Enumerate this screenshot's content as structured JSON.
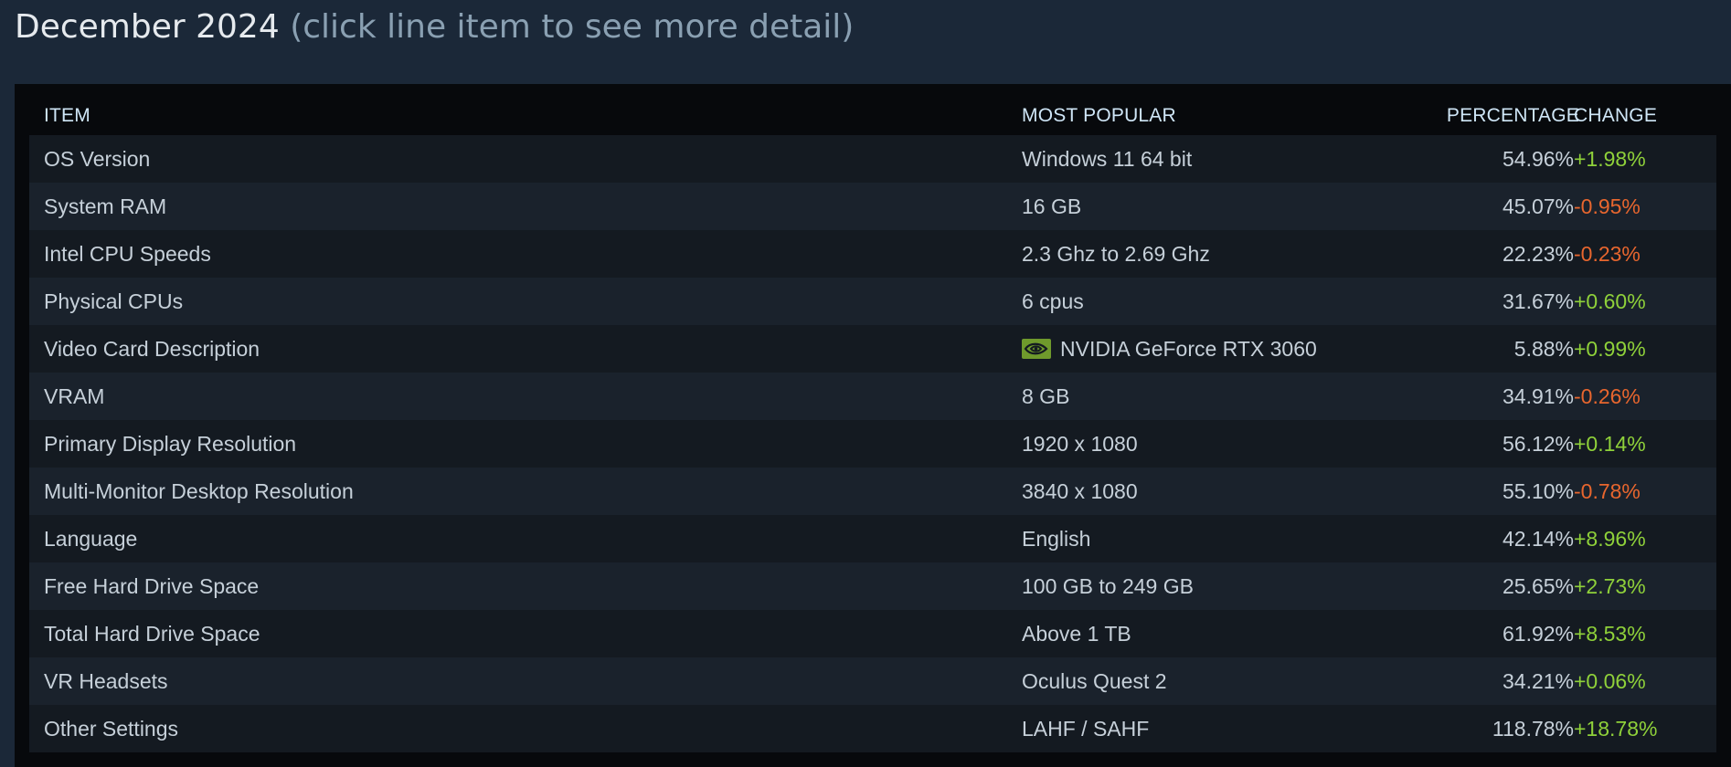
{
  "header": {
    "date": "December 2024",
    "hint": "(click line item to see more detail)"
  },
  "table": {
    "columns": {
      "item": "ITEM",
      "most_popular": "MOST POPULAR",
      "percentage": "PERCENTAGE",
      "change": "CHANGE"
    },
    "rows": [
      {
        "item": "OS Version",
        "most_popular": "Windows 11 64 bit",
        "percentage": "54.96%",
        "change": "+1.98%",
        "trend": "up"
      },
      {
        "item": "System RAM",
        "most_popular": "16 GB",
        "percentage": "45.07%",
        "change": "-0.95%",
        "trend": "down"
      },
      {
        "item": "Intel CPU Speeds",
        "most_popular": "2.3 Ghz to 2.69 Ghz",
        "percentage": "22.23%",
        "change": "-0.23%",
        "trend": "down"
      },
      {
        "item": "Physical CPUs",
        "most_popular": "6 cpus",
        "percentage": "31.67%",
        "change": "+0.60%",
        "trend": "up"
      },
      {
        "item": "Video Card Description",
        "most_popular": "NVIDIA GeForce RTX 3060",
        "percentage": "5.88%",
        "change": "+0.99%",
        "trend": "up",
        "icon": "nvidia-logo-icon"
      },
      {
        "item": "VRAM",
        "most_popular": "8 GB",
        "percentage": "34.91%",
        "change": "-0.26%",
        "trend": "down"
      },
      {
        "item": "Primary Display Resolution",
        "most_popular": "1920 x 1080",
        "percentage": "56.12%",
        "change": "+0.14%",
        "trend": "up"
      },
      {
        "item": "Multi-Monitor Desktop Resolution",
        "most_popular": "3840 x 1080",
        "percentage": "55.10%",
        "change": "-0.78%",
        "trend": "down"
      },
      {
        "item": "Language",
        "most_popular": "English",
        "percentage": "42.14%",
        "change": "+8.96%",
        "trend": "up"
      },
      {
        "item": "Free Hard Drive Space",
        "most_popular": "100 GB to 249 GB",
        "percentage": "25.65%",
        "change": "+2.73%",
        "trend": "up"
      },
      {
        "item": "Total Hard Drive Space",
        "most_popular": "Above 1 TB",
        "percentage": "61.92%",
        "change": "+8.53%",
        "trend": "up"
      },
      {
        "item": "VR Headsets",
        "most_popular": "Oculus Quest 2",
        "percentage": "34.21%",
        "change": "+0.06%",
        "trend": "up"
      },
      {
        "item": "Other Settings",
        "most_popular": "LAHF / SAHF",
        "percentage": "118.78%",
        "change": "+18.78%",
        "trend": "up"
      }
    ]
  },
  "colors": {
    "background": "#1b2838",
    "panel": "#07090c",
    "row_odd": "#141a21",
    "row_even": "#1a222c",
    "positive": "#8fd13a",
    "negative": "#e8662e",
    "header_text": "#cfe6f7"
  }
}
